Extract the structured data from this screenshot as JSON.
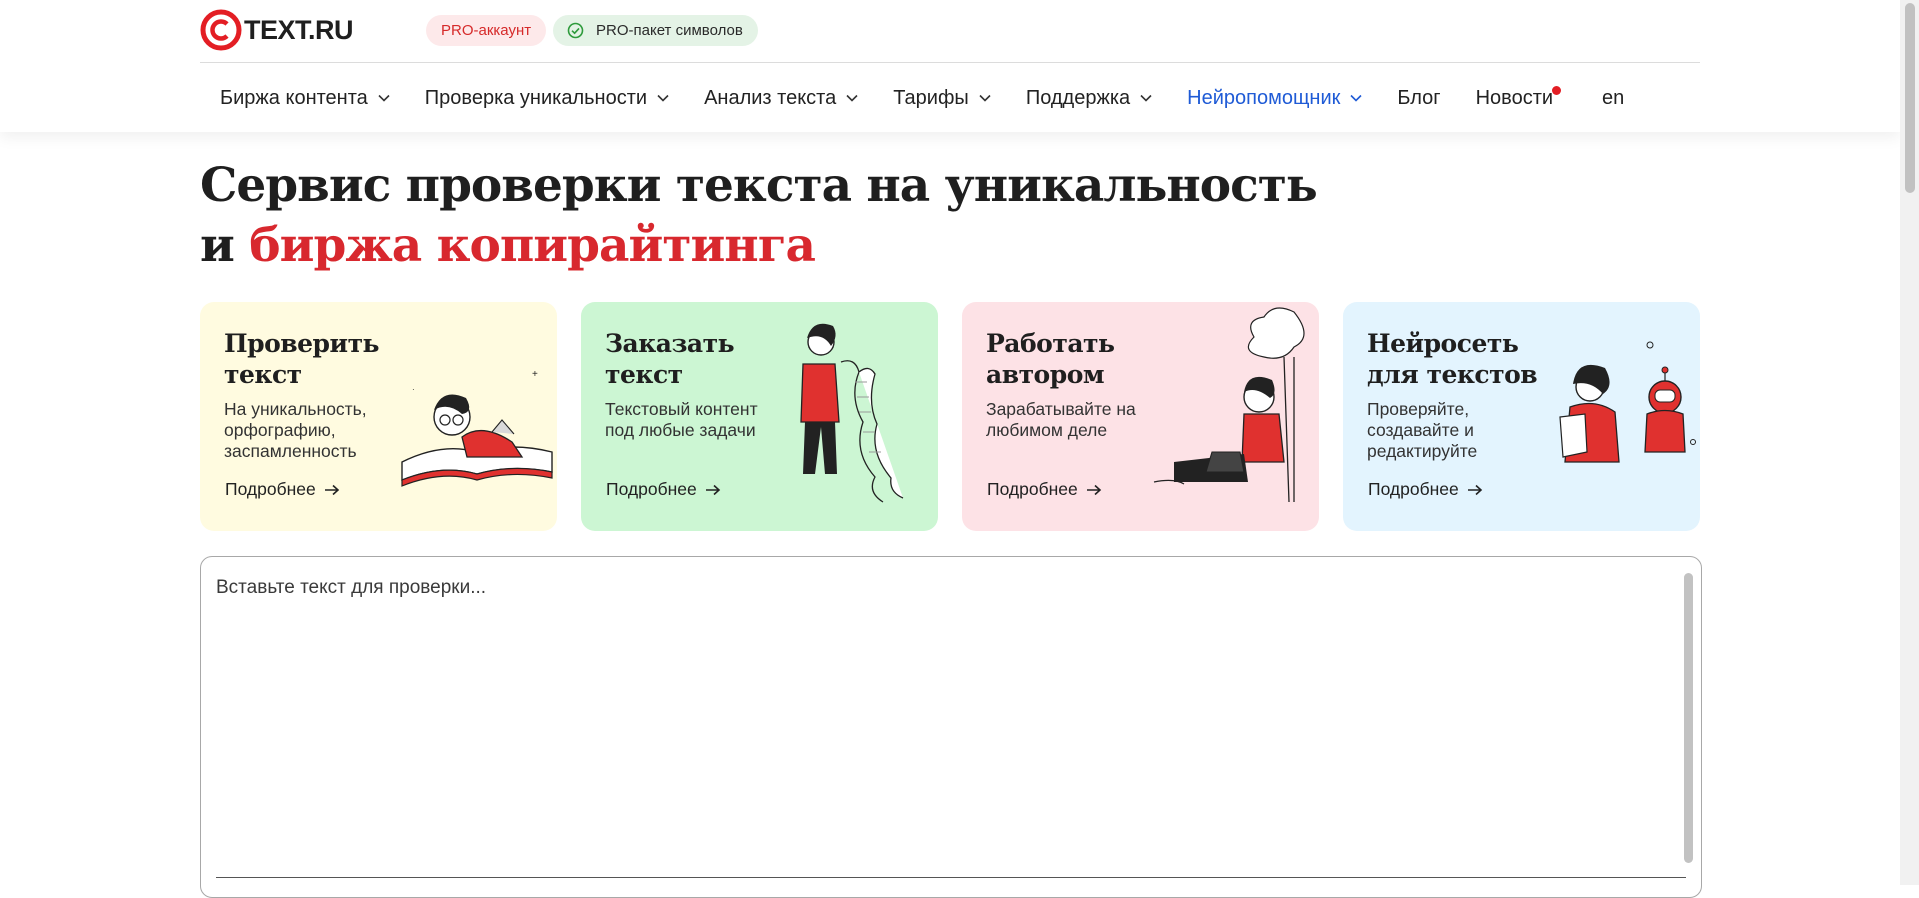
{
  "header": {
    "logo_text": "TEXT.RU",
    "pro_account": "PRO-аккаунт",
    "pro_package": "PRO-пакет символов"
  },
  "nav": {
    "items": [
      {
        "label": "Биржа контента"
      },
      {
        "label": "Проверка уникальности"
      },
      {
        "label": "Анализ текста"
      },
      {
        "label": "Тарифы"
      },
      {
        "label": "Поддержка"
      },
      {
        "label": "Нейропомощник"
      },
      {
        "label": "Блог"
      },
      {
        "label": "Новости"
      },
      {
        "label": "en"
      }
    ]
  },
  "hero": {
    "line1": "Сервис проверки текста на уникальность",
    "line2_prefix": "и",
    "line2_accent": "биржа копирайтинга"
  },
  "cards": [
    {
      "title_line1": "Проверить",
      "title_line2": "текст",
      "subtitle": "На уникальность, орфографию, заспамленность",
      "link": "Подробнее"
    },
    {
      "title_line1": "Заказать",
      "title_line2": "текст",
      "subtitle": "Текстовый контент под любые задачи",
      "link": "Подробнее"
    },
    {
      "title_line1": "Работать",
      "title_line2": "автором",
      "subtitle": "Зарабатывайте на любимом деле",
      "link": "Подробнее"
    },
    {
      "title_line1": "Нейросеть",
      "title_line2": "для текстов",
      "subtitle": "Проверяйте, создавайте и редактируйте",
      "link": "Подробнее"
    }
  ],
  "editor": {
    "placeholder": "Вставьте текст для проверки..."
  },
  "colors": {
    "accent_red": "#d8282e",
    "accent_blue": "#1f5bd6",
    "card_yellow": "#fffbe0",
    "card_green": "#ccf6d3",
    "card_pink": "#fde2e6",
    "card_blue": "#e3f4fe"
  }
}
